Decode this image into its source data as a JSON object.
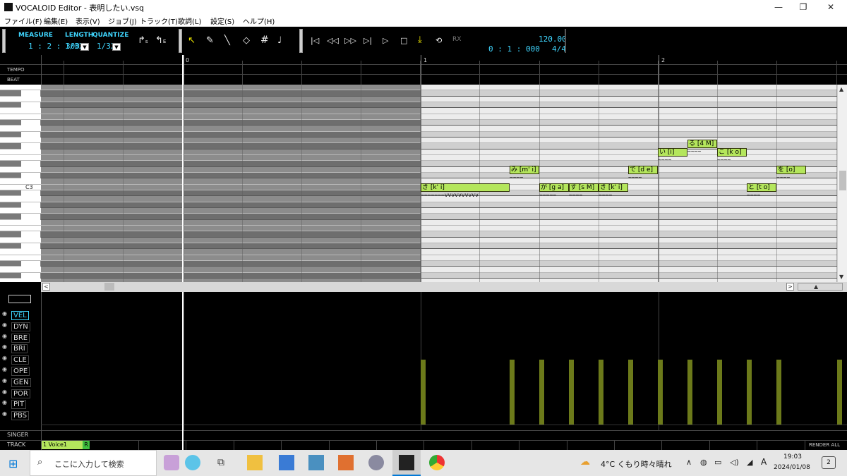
{
  "window": {
    "title": "VOCALOID Editor - 表明したい.vsq",
    "minimize": "—",
    "maximize": "❐",
    "close": "✕"
  },
  "menu": [
    "ファイル(F)",
    "編集(E)",
    "表示(V)",
    "ジョブ(J)",
    "トラック(T)",
    "歌詞(L)",
    "設定(S)",
    "ヘルプ(H)"
  ],
  "toolbar": {
    "measure_label": "MEASURE",
    "measure_value": "1 : 2 : 300",
    "length_label": "LENGTH",
    "length_value": "1/32",
    "quantize_label": "QUANTIZE",
    "quantize_value": "1/32",
    "time_value": "0 : 1 : 000",
    "tempo_value": "120.00",
    "beat_value": "4/4"
  },
  "ruler": {
    "tempo_label": "TEMPO",
    "beat_label": "BEAT",
    "bars": [
      "0",
      "1",
      "2"
    ]
  },
  "piano": {
    "c3_label": "C3"
  },
  "notes": [
    {
      "lyric": "き [k' i]",
      "vib": "~~~~~~~vvvvvvvvvv"
    },
    {
      "lyric": "み [m' i]",
      "vib": "~~~~"
    },
    {
      "lyric": "が [g a]",
      "vib": "~~~~~"
    },
    {
      "lyric": "す [s M]",
      "vib": "~~~~"
    },
    {
      "lyric": "き [k' i]",
      "vib": "~~~~"
    },
    {
      "lyric": "で [d e]",
      "vib": "~~~~"
    },
    {
      "lyric": "い [i]",
      "vib": "~~~~"
    },
    {
      "lyric": "る [4 M]",
      "vib": "~~~~"
    },
    {
      "lyric": "こ [k o]",
      "vib": "~~~~"
    },
    {
      "lyric": "と [t o]",
      "vib": "~~~~"
    },
    {
      "lyric": "を [o]",
      "vib": "~~~~"
    }
  ],
  "curves": [
    "VEL",
    "DYN",
    "BRE",
    "BRI",
    "CLE",
    "OPE",
    "GEN",
    "POR",
    "PIT",
    "PBS"
  ],
  "bottom": {
    "singer_label": "SINGER",
    "track_label": "TRACK",
    "track_name": "1 Voice1",
    "render_flag": "R",
    "render_all": "RENDER ALL"
  },
  "taskbar": {
    "search_placeholder": "ここに入力して検索",
    "weather": "4°C  くもり時々晴れ",
    "ime": "A",
    "time": "19:03",
    "date": "2024/01/08",
    "notify_count": "2"
  }
}
